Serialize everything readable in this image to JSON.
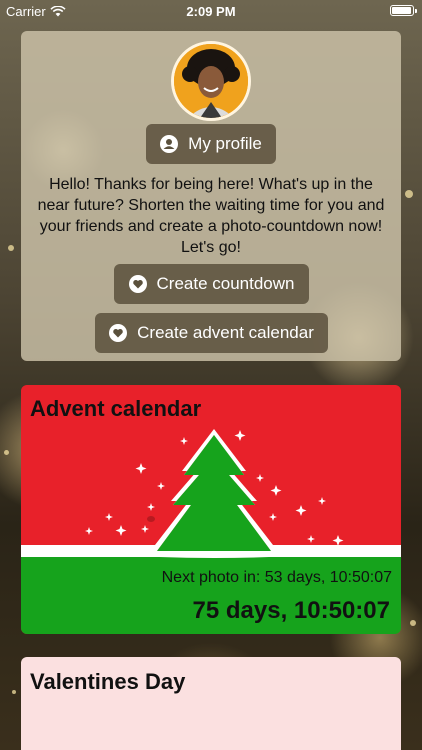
{
  "status_bar": {
    "carrier": "Carrier",
    "time": "2:09 PM",
    "wifi_icon": "wifi-icon",
    "battery_icon": "battery-icon"
  },
  "welcome": {
    "avatar_icon": "user-photo-avatar",
    "profile_button": {
      "label": "My profile",
      "icon": "user-circle-icon"
    },
    "message": "Hello! Thanks for being here! What's up in the near future? Shorten the waiting time for you and your friends and create a photo-countdown now! Let's go!",
    "create_countdown_button": {
      "label": "Create countdown",
      "icon": "heart-icon"
    },
    "create_advent_button": {
      "label": "Create advent calendar",
      "icon": "heart-icon"
    }
  },
  "countdowns": [
    {
      "title": "Advent calendar",
      "next_photo": "Next photo in: 53 days, 10:50:07",
      "remaining": "75 days, 10:50:07",
      "colors": {
        "top": "#e8212a",
        "bottom": "#16a31c",
        "tree": "#16a31c"
      }
    },
    {
      "title": "Valentines Day",
      "colors": {
        "background": "#fbe0e0"
      }
    }
  ]
}
